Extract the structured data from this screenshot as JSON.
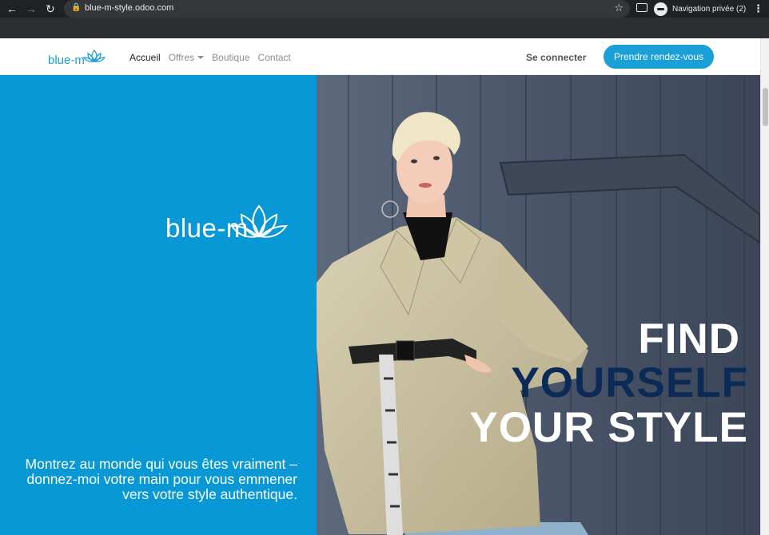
{
  "browser": {
    "url": "blue-m-style.odoo.com",
    "profile_label": "Navigation privée (2)"
  },
  "site": {
    "logo_text": "blue-m",
    "nav": [
      {
        "label": "Accueil",
        "active": true
      },
      {
        "label": "Offres",
        "dropdown": true
      },
      {
        "label": "Boutique"
      },
      {
        "label": "Contact"
      }
    ],
    "signin_label": "Se connecter",
    "cta_label": "Prendre rendez-vous",
    "brand_color": "#0898d5"
  },
  "hero": {
    "logo_text": "blue-m",
    "line1": "FIND",
    "line2": "YOURSELF",
    "line3": "YOUR STYLE",
    "tagline": "Montrez au monde qui vous êtes vraiment – donnez-moi votre main pour vous emmener vers votre style authentique.",
    "colors": {
      "panel": "#0898d5",
      "accent_text": "#0b2a56"
    }
  }
}
